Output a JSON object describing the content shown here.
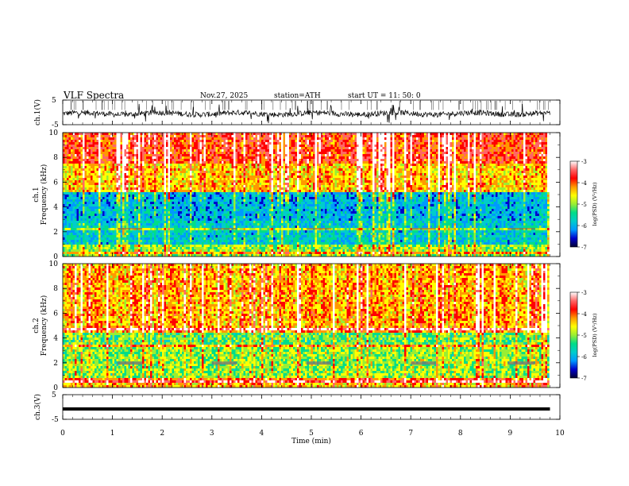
{
  "header": {
    "title": "VLF  Spectra",
    "date": "Nov.27, 2025",
    "station": "station=ATH",
    "start": "start  UT  =    11: 50: 0"
  },
  "colorbar": {
    "label": "log(PSD) (V²/Hz)",
    "ticks": [
      "-3",
      "-4",
      "-5",
      "-6",
      "-7"
    ],
    "colors": [
      "#ffffff",
      "#ff6666",
      "#ff0000",
      "#ff9900",
      "#ffff00",
      "#99ee33",
      "#00dd88",
      "#00cccc",
      "#0099ff",
      "#0000cc",
      "#000033"
    ]
  },
  "chart_data": [
    {
      "type": "line",
      "name": "ch1-waveform",
      "ylabel": "ch.1(V)",
      "yticks": [
        "5",
        "-5"
      ],
      "ylim": [
        -5,
        5
      ],
      "xlim": [
        0,
        10
      ],
      "description_level": "noisy signal around -0.5 V with spikes reaching +/-5 V",
      "baseline": -0.5
    },
    {
      "type": "heatmap",
      "name": "ch1-spectrogram",
      "ylabel": "ch.1\nFrequency  (kHz)",
      "yticks": [
        "0",
        "2",
        "4",
        "6",
        "8",
        "10"
      ],
      "ylim": [
        0,
        10
      ],
      "xlim": [
        0,
        9.8
      ],
      "bands": [
        {
          "from": 0,
          "to": 1.0,
          "level": -5.2
        },
        {
          "from": 1.0,
          "to": 2.8,
          "level": -6.0
        },
        {
          "from": 2.8,
          "to": 5.2,
          "level": -6.2
        },
        {
          "from": 5.2,
          "to": 7.5,
          "level": -4.6
        },
        {
          "from": 7.5,
          "to": 10,
          "level": -4.0
        }
      ]
    },
    {
      "type": "heatmap",
      "name": "ch2-spectrogram",
      "ylabel": "ch.2\nFrequency  (kHz)",
      "yticks": [
        "0",
        "2",
        "4",
        "6",
        "8",
        "10"
      ],
      "ylim": [
        0,
        10
      ],
      "xlim": [
        0,
        9.8
      ],
      "bands": [
        {
          "from": 0,
          "to": 0.6,
          "level": -4.6
        },
        {
          "from": 0.6,
          "to": 3.2,
          "level": -5.2
        },
        {
          "from": 3.2,
          "to": 4.6,
          "level": -5.4
        },
        {
          "from": 4.6,
          "to": 10,
          "level": -4.5
        }
      ]
    },
    {
      "type": "line",
      "name": "ch3-waveform",
      "ylabel": "ch.3(V)",
      "yticks": [
        "5",
        "-5"
      ],
      "ylim": [
        -5,
        5
      ],
      "xlim": [
        0,
        10
      ],
      "baseline": -0.8
    }
  ],
  "xaxis": {
    "label": "Time  (min)",
    "ticks": [
      "0",
      "1",
      "2",
      "3",
      "4",
      "5",
      "6",
      "7",
      "8",
      "9",
      "10"
    ],
    "range": [
      0,
      10
    ]
  }
}
